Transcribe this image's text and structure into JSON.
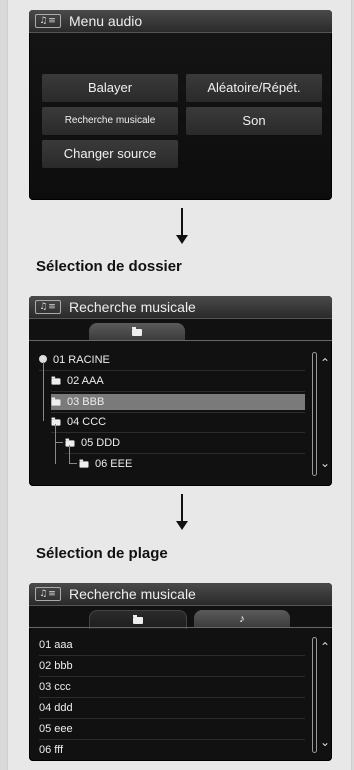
{
  "screen1": {
    "title": "Menu audio",
    "title_icon": "audio-menu-icon",
    "buttons": {
      "balayer": "Balayer",
      "aleatoire": "Aléatoire/Répét.",
      "recherche": "Recherche musicale",
      "son": "Son",
      "changer": "Changer source"
    }
  },
  "label_dossier": "Sélection de dossier",
  "screen2": {
    "title": "Recherche musicale",
    "tab_folder_icon": "folder-icon",
    "rows": [
      "01 RACINE",
      "02 AAA",
      "03 BBB",
      "04 CCC",
      "05 DDD",
      "06 EEE"
    ],
    "selected_row": "03 BBB"
  },
  "label_plage": "Sélection de plage",
  "screen3": {
    "title": "Recherche musicale",
    "tab_music_glyph": "♪",
    "rows": [
      "01 aaa",
      "02 bbb",
      "03 ccc",
      "04 ddd",
      "05 eee",
      "06 fff"
    ]
  },
  "icons": {
    "scroll_up": "⌃",
    "scroll_down": "⌄"
  }
}
